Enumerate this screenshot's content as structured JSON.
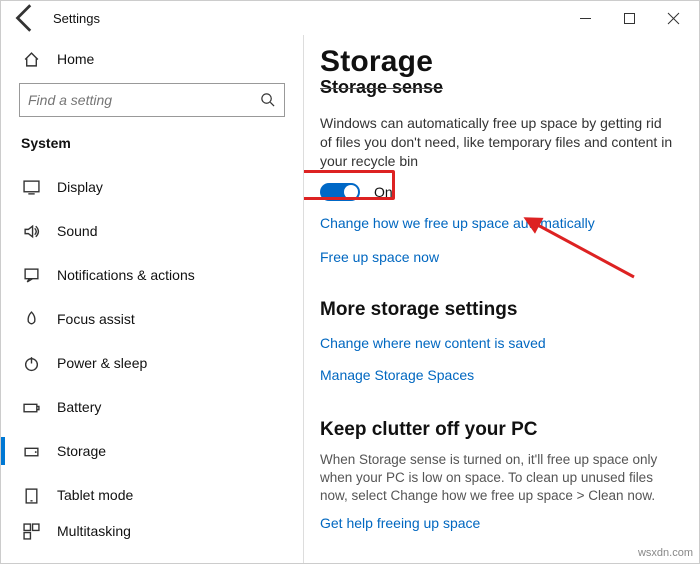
{
  "window": {
    "title": "Settings"
  },
  "sidebar": {
    "home": "Home",
    "search_placeholder": "Find a setting",
    "section": "System",
    "items": [
      {
        "label": "Display"
      },
      {
        "label": "Sound"
      },
      {
        "label": "Notifications & actions"
      },
      {
        "label": "Focus assist"
      },
      {
        "label": "Power & sleep"
      },
      {
        "label": "Battery"
      },
      {
        "label": "Storage"
      },
      {
        "label": "Tablet mode"
      },
      {
        "label": "Multitasking"
      }
    ]
  },
  "main": {
    "heading": "Storage",
    "cut_heading": "Storage sense",
    "description": "Windows can automatically free up space by getting rid of files you don't need, like temporary files and content in your recycle bin",
    "toggle_state": "On",
    "link_change_auto": "Change how we free up space automatically",
    "link_free_now": "Free up space now",
    "more_heading": "More storage settings",
    "link_change_where": "Change where new content is saved",
    "link_manage": "Manage Storage Spaces",
    "clutter_heading": "Keep clutter off your PC",
    "clutter_desc": "When Storage sense is turned on, it'll free up space only when your PC is low on space. To clean up unused files now, select Change how we free up space > Clean now.",
    "link_help": "Get help freeing up space"
  },
  "watermark": "wsxdn.com"
}
